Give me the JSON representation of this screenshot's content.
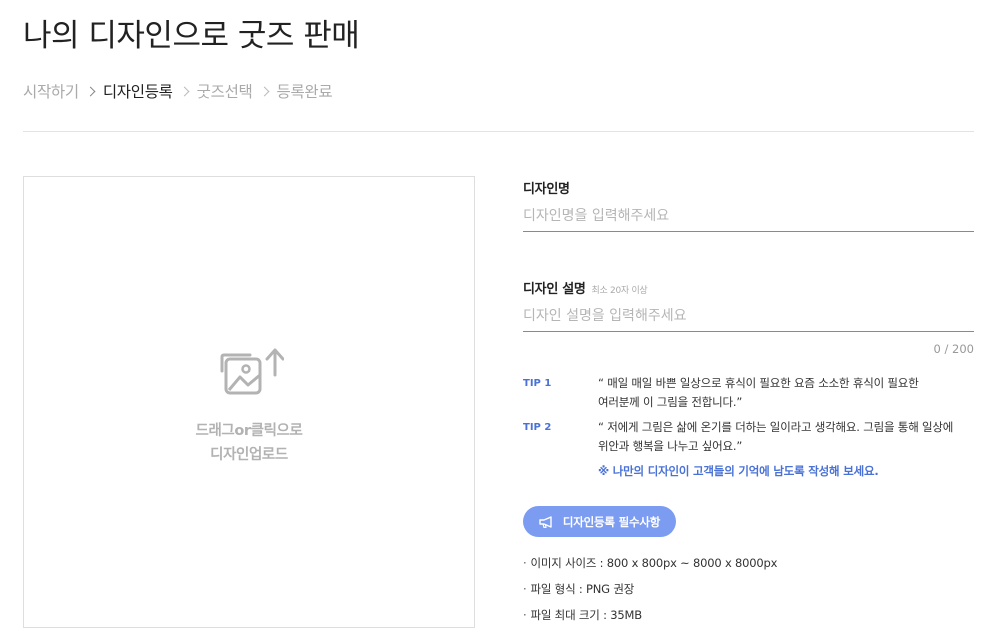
{
  "page": {
    "title": "나의 디자인으로 굿즈 판매"
  },
  "breadcrumb": [
    {
      "label": "시작하기",
      "active": false
    },
    {
      "label": "디자인등록",
      "active": true
    },
    {
      "label": "굿즈선택",
      "active": false
    },
    {
      "label": "등록완료",
      "active": false
    }
  ],
  "upload": {
    "icon": "image-upload-icon",
    "line1": "드래그or클릭으로",
    "line2": "디자인업로드"
  },
  "form": {
    "name": {
      "label": "디자인명",
      "placeholder": "디자인명을 입력해주세요"
    },
    "description": {
      "label": "디자인 설명",
      "hint": "최소 20자 이상",
      "placeholder": "디자인 설명을 입력해주세요",
      "counter": "0 / 200"
    }
  },
  "tips": [
    {
      "label": "TIP 1",
      "lines": [
        "“ 매일 매일 바쁜 일상으로 휴식이 필요한 요즘 소소한 휴식이 필요한",
        "여러분께 이 그림을 전합니다.”"
      ]
    },
    {
      "label": "TIP 2",
      "lines": [
        "“ 저에게 그림은 삶에 온기를 더하는 일이라고 생각해요. 그림을 통해 일상에",
        "위안과 행복을 나누고 싶어요.”"
      ]
    }
  ],
  "tip_note": "※ 나만의 디자인이 고객들의 기억에 남도록 작성해 보세요.",
  "requirements_button": {
    "label": "디자인등록 필수사항",
    "icon": "megaphone-icon",
    "color": "#7c9cf2"
  },
  "specs": [
    "이미지 사이즈 : 800 x 800px ~ 8000 x 8000px",
    "파일 형식 : PNG 권장",
    "파일 최대 크기 : 35MB"
  ],
  "colors": {
    "accent": "#4a72d6",
    "button": "#7c9cf2",
    "text": "#222222",
    "muted": "#aaaaaa"
  }
}
